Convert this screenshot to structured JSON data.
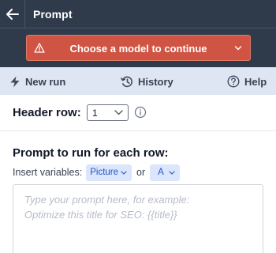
{
  "header": {
    "title": "Prompt"
  },
  "warning": {
    "text": "Choose a model to continue"
  },
  "toolbar": {
    "new_run": "New run",
    "history": "History",
    "help": "Help"
  },
  "header_row": {
    "label": "Header row:",
    "selected": "1"
  },
  "prompt": {
    "label": "Prompt to run for each row:",
    "insert_label": "Insert variables:",
    "variables": [
      "Picture",
      "A"
    ],
    "or_text": "or",
    "placeholder_line1": "Type your prompt here, for example:",
    "placeholder_line2": "Optimize this title for SEO: {{title}}"
  },
  "colors": {
    "header_bg": "#2f3a4b",
    "warning_bg": "#cf5443",
    "toolbar_bg": "#dfe6f3",
    "chip_bg": "#dbe5fb",
    "chip_text": "#2456c4"
  },
  "icons": [
    "back-arrow-icon",
    "warning-triangle-icon",
    "chevron-down-icon",
    "lightning-icon",
    "history-icon",
    "help-circle-icon",
    "info-icon"
  ]
}
